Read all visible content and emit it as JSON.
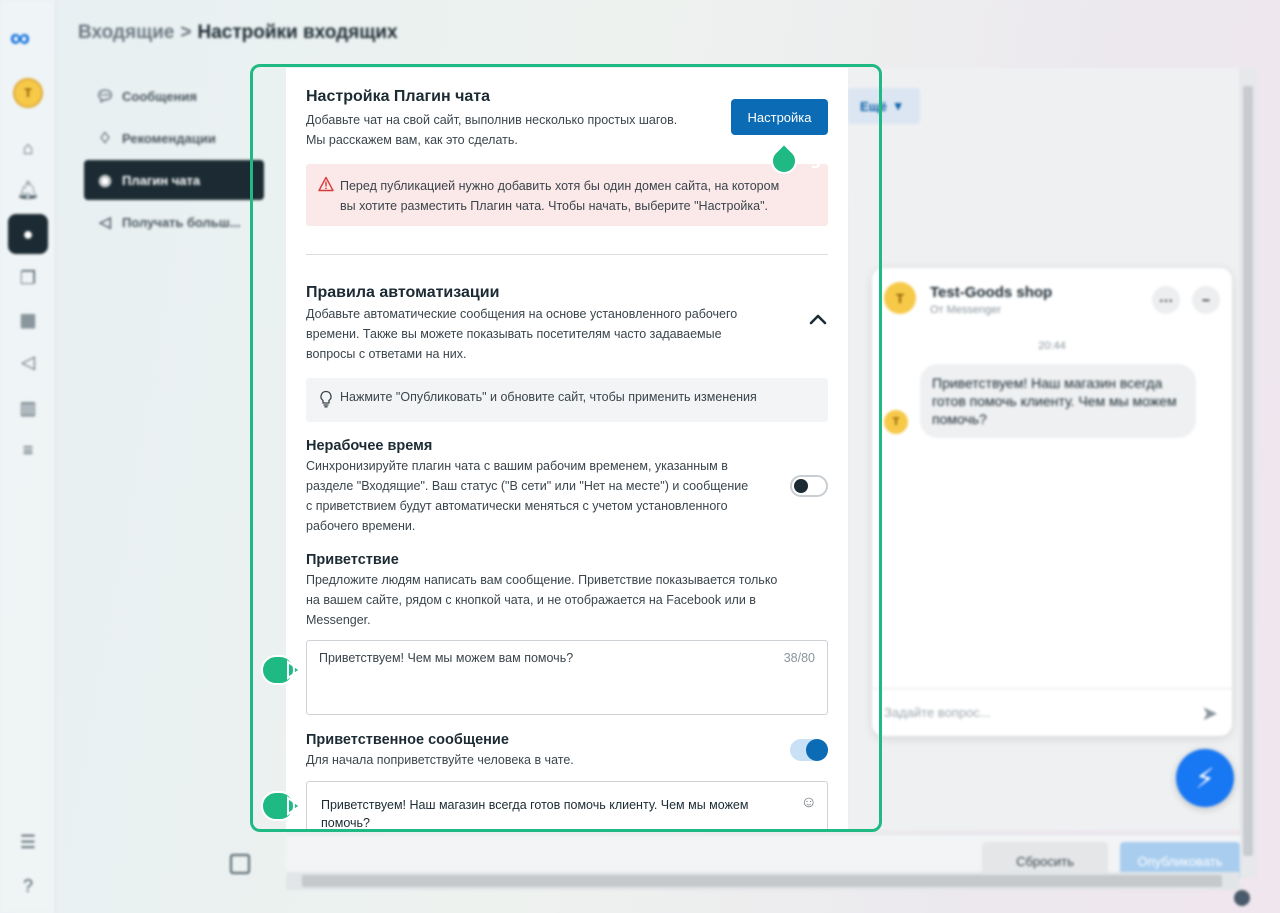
{
  "rail": {
    "logo": "∞",
    "avatar_initial": "T",
    "icons": [
      "home-icon",
      "bell-icon",
      "chat-icon",
      "pages-icon",
      "table-icon",
      "megaphone-icon",
      "bar-chart-icon",
      "menu-icon",
      "list-icon",
      "help-icon"
    ]
  },
  "breadcrumb": {
    "parent": "Входящие",
    "separator": ">",
    "current": "Настройки входящих"
  },
  "subnav": [
    {
      "label": "Сообщения",
      "icon": "chat-bubbles-icon"
    },
    {
      "label": "Рекомендации",
      "icon": "lightbulb-icon"
    },
    {
      "label": "Плагин чата",
      "icon": "messenger-icon"
    },
    {
      "label": "Получать больш...",
      "icon": "megaphone-icon"
    }
  ],
  "plugin": {
    "title": "Настройка Плагин чата",
    "desc_line1": "Добавьте чат на свой сайт, выполнив несколько простых шагов.",
    "desc_line2": "Мы расскажем вам, как это сделать.",
    "setup_button": "Настройка",
    "alert_line1": "Перед публикацией нужно добавить хотя бы один домен сайта, на котором",
    "alert_line2": "вы хотите разместить Плагин чата. Чтобы начать, выберите \"Настройка\"."
  },
  "automation": {
    "title": "Правила автоматизации",
    "desc_line1": "Добавьте автоматические сообщения на основе установленного рабочего",
    "desc_line2": "времени. Также вы можете показывать посетителям часто задаваемые",
    "desc_line3": "вопросы с ответами на них.",
    "hint": "Нажмите \"Опубликовать\" и обновите сайт, чтобы применить изменения"
  },
  "offhours": {
    "title": "Нерабочее время",
    "line1": "Синхронизируйте плагин чата с вашим рабочим временем, указанным в",
    "line2": "разделе \"Входящие\". Ваш статус (\"В сети\" или \"Нет на месте\") и сообщение",
    "line3": "с приветствием будут автоматически меняться с учетом установленного",
    "line4": "рабочего времени.",
    "enabled": false
  },
  "greeting": {
    "title": "Приветствие",
    "line1": "Предложите людям написать вам сообщение. Приветствие показывается только",
    "line2": "на вашем сайте, рядом с кнопкой чата, и не отображается на Facebook или в",
    "line3": "Messenger.",
    "value": "Приветствуем! Чем мы можем вам помочь?",
    "count": "38/80"
  },
  "welcome": {
    "title": "Приветственное сообщение",
    "desc": "Для начала поприветствуйте человека в чате.",
    "enabled": true,
    "value_line1": "Приветствуем! Наш магазин всегда готов помочь клиенту. Чем мы можем",
    "value_line2": "помочь?"
  },
  "markers": {
    "m1": "1",
    "m2": "2",
    "m3": "3"
  },
  "preview": {
    "more_button": "Ещё",
    "chat_name": "Test-Goods shop",
    "chat_sub": "От Messenger",
    "avatar_initial": "T",
    "time": "20:44",
    "bubble": "Приветствуем! Наш магазин всегда готов помочь клиенту. Чем мы можем помочь?",
    "input_placeholder": "Задайте вопрос..."
  },
  "footer": {
    "reset": "Сбросить",
    "publish": "Опубликовать"
  },
  "colors": {
    "accent": "#0b6bb4",
    "highlight": "#1fba84",
    "alert_bg": "#fbe8e8"
  }
}
